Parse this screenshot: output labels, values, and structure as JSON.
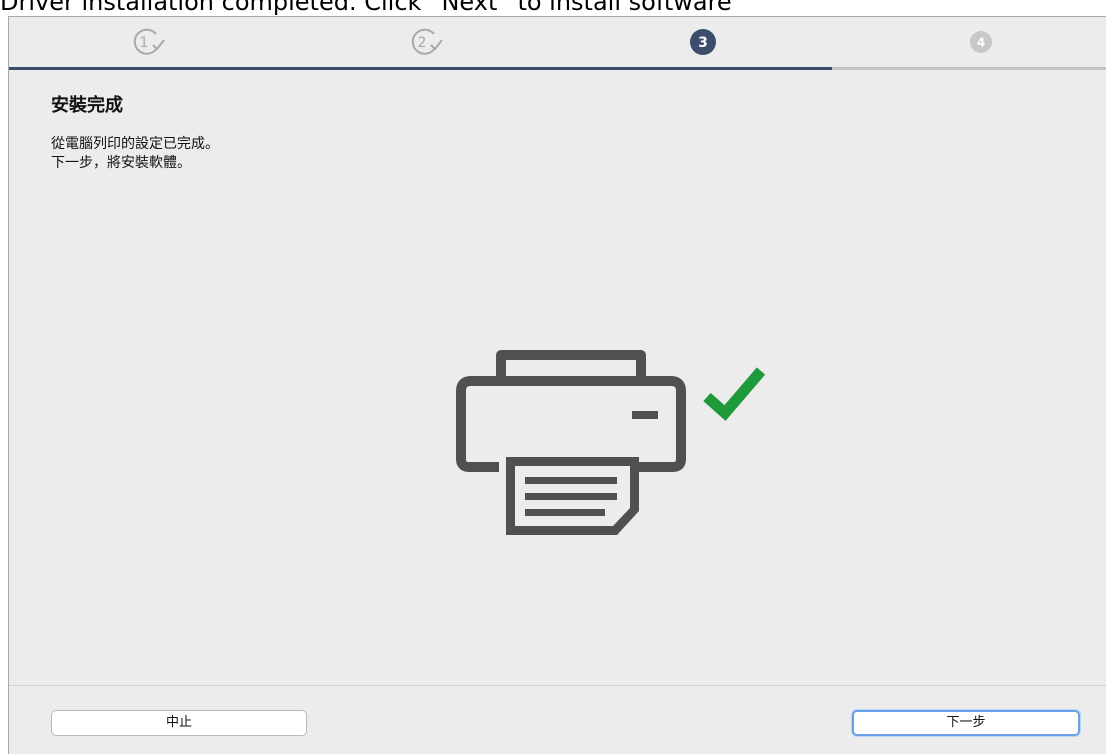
{
  "caption": "Driver installation completed. Click “Next” to install software",
  "steps": [
    {
      "label": "1",
      "state": "done"
    },
    {
      "label": "2",
      "state": "done"
    },
    {
      "label": "3",
      "state": "current"
    },
    {
      "label": "4",
      "state": "pending"
    }
  ],
  "progress": {
    "completed_fraction": 0.75
  },
  "content": {
    "title": "安裝完成",
    "line1": "從電腦列印的設定已完成。",
    "line2": "下一步，將安裝軟體。"
  },
  "illustration": {
    "icon": "printer-icon",
    "status_icon": "checkmark-icon",
    "check_color": "#1f9a3a"
  },
  "buttons": {
    "cancel_label": "中止",
    "next_label": "下一步"
  },
  "colors": {
    "accent": "#3b4d6b",
    "pending": "#c4c4c4",
    "background": "#ececec"
  }
}
